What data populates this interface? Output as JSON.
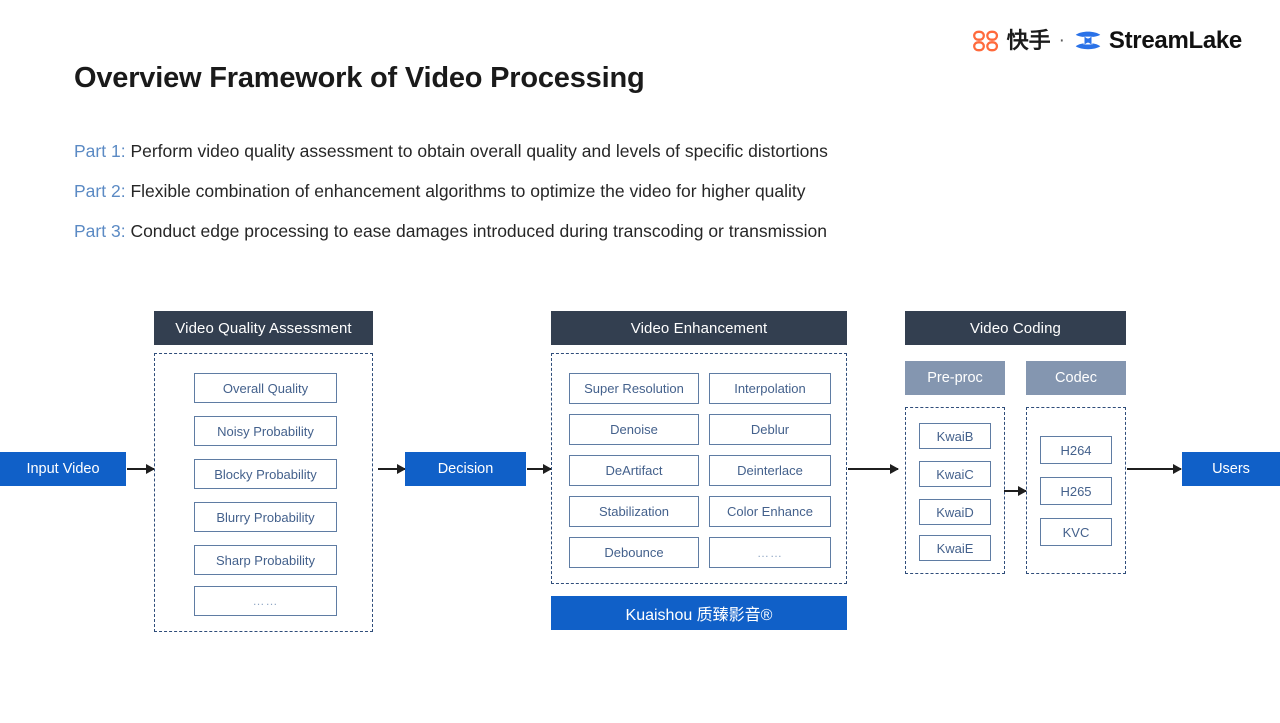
{
  "logo": {
    "kuaishou_text": "快手",
    "separator": "·",
    "streamlake_text": "StreamLake",
    "kuaishou_color": "#ff6a3c",
    "streamlake_color": "#2a72e8"
  },
  "title": "Overview Framework of Video Processing",
  "parts": [
    {
      "tag": "Part 1:",
      "text": "Perform video quality assessment to obtain overall quality and levels of specific distortions"
    },
    {
      "tag": "Part 2:",
      "text": "Flexible combination of enhancement algorithms to optimize the video for higher quality"
    },
    {
      "tag": "Part 3:",
      "text": "Conduct edge processing to ease damages introduced during transcoding or transmission"
    }
  ],
  "diagram": {
    "input_label": "Input Video",
    "decision_label": "Decision",
    "users_label": "Users",
    "vqa": {
      "header": "Video Quality Assessment",
      "items": [
        "Overall Quality",
        "Noisy Probability",
        "Blocky Probability",
        "Blurry Probability",
        "Sharp Probability",
        "……"
      ]
    },
    "enhancement": {
      "header": "Video Enhancement",
      "left_items": [
        "Super Resolution",
        "Denoise",
        "DeArtifact",
        "Stabilization",
        "Debounce"
      ],
      "right_items": [
        "Interpolation",
        "Deblur",
        "Deinterlace",
        "Color Enhance",
        "……"
      ],
      "banner": "Kuaishou 质臻影音®"
    },
    "coding": {
      "header": "Video Coding",
      "preproc_header": "Pre-proc",
      "codec_header": "Codec",
      "preproc_items": [
        "KwaiB",
        "KwaiC",
        "KwaiD",
        "KwaiE"
      ],
      "codec_items": [
        "H264",
        "H265",
        "KVC"
      ]
    }
  },
  "colors": {
    "header_navy": "#333f50",
    "sub_gray": "#8496b0",
    "accent_blue": "#1060c8",
    "cell_text": "#44618c",
    "part_tag": "#5b8ac4"
  }
}
